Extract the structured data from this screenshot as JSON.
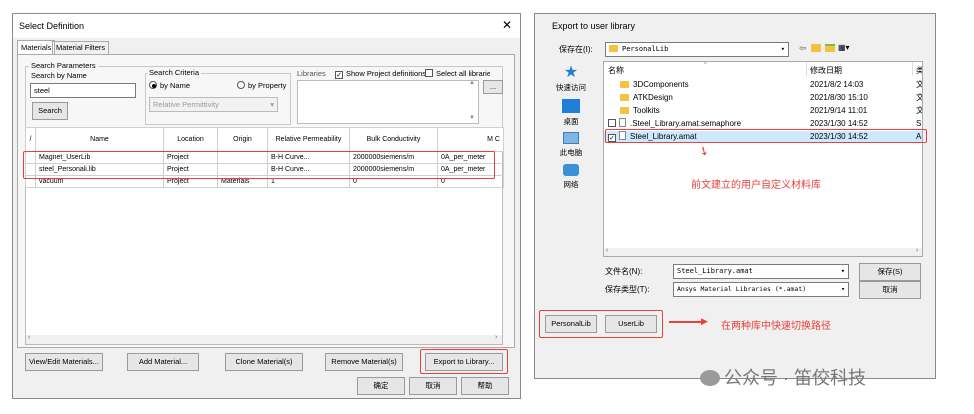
{
  "left": {
    "title": "Select Definition",
    "tabs": [
      "Materials",
      "Material Filters"
    ],
    "search_params_label": "Search Parameters",
    "search_by_name_label": "Search by Name",
    "search_value": "steel",
    "search_button": "Search",
    "criteria_label": "Search Criteria",
    "by_name": "by Name",
    "by_property": "by Property",
    "criteria_select": "Relative Permittivity",
    "libraries_label": "Libraries",
    "show_project": "Show Project definitions",
    "select_all": "Select all libraries",
    "browse_btn": "...",
    "columns": [
      "/",
      "Name",
      "Location",
      "Origin",
      "Relative Permeability",
      "Bulk Conductivity",
      "M C"
    ],
    "rows": [
      [
        "",
        "Magnet_UserLib",
        "Project",
        "",
        "B-H Curve...",
        "2000000siemens/m",
        "0A_per_meter"
      ],
      [
        "",
        "steel_Personali.lib",
        "Project",
        "",
        "B-H Curve...",
        "2000000siemens/m",
        "0A_per_meter"
      ],
      [
        "",
        "vacuum",
        "Project",
        "Materials",
        "1",
        "0",
        "0"
      ]
    ],
    "buttons": [
      "View/Edit Materials...",
      "Add Material...",
      "Clone Material(s)",
      "Remove Material(s)",
      "Export to Library..."
    ],
    "ok": "确定",
    "cancel": "取消",
    "help": "帮助"
  },
  "right": {
    "title": "Export to user library",
    "save_in_label": "保存在(I):",
    "save_in_value": "PersonalLib",
    "nav": [
      "快速访问",
      "桌面",
      "此电脑",
      "网络"
    ],
    "col_name": "名称",
    "col_date": "修改日期",
    "col_type": "类",
    "files": [
      {
        "name": "3DComponents",
        "date": "2021/8/2 14:03",
        "type": "文",
        "kind": "folder"
      },
      {
        "name": "ATKDesign",
        "date": "2021/8/30 15:10",
        "type": "文",
        "kind": "folder"
      },
      {
        "name": "Toolkits",
        "date": "2021/9/14 11:01",
        "type": "文",
        "kind": "folder"
      },
      {
        "name": ".Steel_Library.amat.semaphore",
        "date": "2023/1/30 14:52",
        "type": "S",
        "kind": "file"
      },
      {
        "name": "Steel_Library.amat",
        "date": "2023/1/30 14:52",
        "type": "A",
        "kind": "file"
      }
    ],
    "annotation1": "前文建立的用户自定义材料库",
    "filename_label": "文件名(N):",
    "filename_value": "Steel_Library.amat",
    "filetype_label": "保存类型(T):",
    "filetype_value": "Ansys Material Libraries (*.amat)",
    "save_btn": "保存(S)",
    "cancel_btn": "取消",
    "personal_btn": "PersonalLib",
    "user_btn": "UserLib",
    "annotation2": "在两种库中快速切换路径"
  },
  "watermark": "公众号 · 笛佼科技",
  "colors": {
    "annotation": "#e8413c",
    "folder": "#f3c241"
  }
}
